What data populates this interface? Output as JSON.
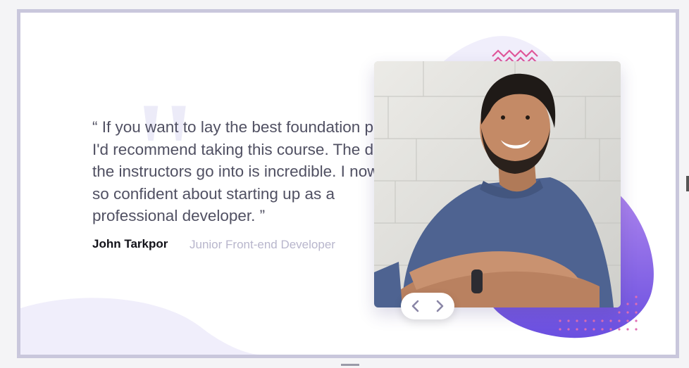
{
  "testimonial": {
    "quote": "“ If you want to lay the best foundation possible I'd recommend taking this course. The depth the instructors go into is incredible. I now feel so confident about starting up as a professional developer. ”",
    "author": "John Tarkpor",
    "role": "Junior Front-end Developer"
  },
  "photo": {
    "alt": "Smiling man in blue t-shirt with crossed arms"
  },
  "navigation": {
    "prev_icon": "chevron-left-icon",
    "next_icon": "chevron-right-icon"
  },
  "colors": {
    "accent_purple": "#7a5ee0",
    "blob_light": "#f0eefb",
    "zigzag_pink": "#e0579a",
    "chevron": "#8a86a6"
  }
}
